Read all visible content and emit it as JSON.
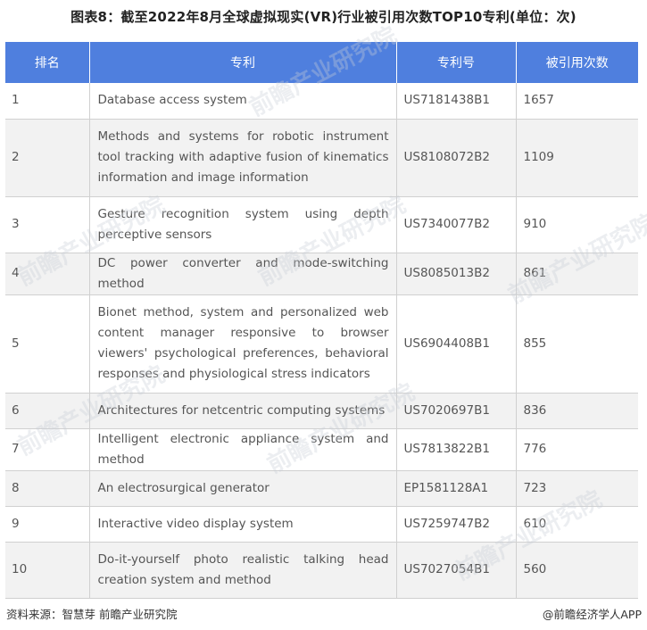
{
  "title": "图表8：截至2022年8月全球虚拟现实(VR)行业被引用次数TOP10专利(单位：次)",
  "table": {
    "headers": [
      "排名",
      "专利",
      "专利号",
      "被引用次数"
    ],
    "rows": [
      {
        "rank": "1",
        "name": "Database access system",
        "patent_no": "US7181438B1",
        "citations": "1657"
      },
      {
        "rank": "2",
        "name": "Methods and systems for robotic instrument tool tracking with adaptive fusion of kinematics information and image information",
        "patent_no": "US8108072B2",
        "citations": "1109"
      },
      {
        "rank": "3",
        "name": "Gesture recognition system using depth perceptive sensors",
        "patent_no": "US7340077B2",
        "citations": "910"
      },
      {
        "rank": "4",
        "name": "DC power converter and mode-switching method",
        "patent_no": "US8085013B2",
        "citations": "861"
      },
      {
        "rank": "5",
        "name": "Bionet method, system and personalized web content manager responsive to browser viewers' psychological preferences, behavioral responses and physiological stress indicators",
        "patent_no": "US6904408B1",
        "citations": "855"
      },
      {
        "rank": "6",
        "name": "Architectures for netcentric computing systems",
        "patent_no": "US7020697B1",
        "citations": "836"
      },
      {
        "rank": "7",
        "name": "Intelligent electronic appliance system and method",
        "patent_no": "US7813822B1",
        "citations": "776"
      },
      {
        "rank": "8",
        "name": "An electrosurgical generator",
        "patent_no": "EP1581128A1",
        "citations": "723"
      },
      {
        "rank": "9",
        "name": "Interactive video display system",
        "patent_no": "US7259747B2",
        "citations": "610"
      },
      {
        "rank": "10",
        "name": "Do-it-yourself photo realistic talking head creation system and method",
        "patent_no": "US7027054B1",
        "citations": "560"
      }
    ]
  },
  "footer": {
    "source": "资料来源：智慧芽 前瞻产业研究院",
    "credit": "@前瞻经济学人APP"
  },
  "watermark_text": "前瞻产业研究院",
  "colors": {
    "header_bg": "#4f7fde",
    "header_text": "#ffffff",
    "row_alt_bg": "#f2f2f2",
    "border": "#d0d0d0"
  }
}
